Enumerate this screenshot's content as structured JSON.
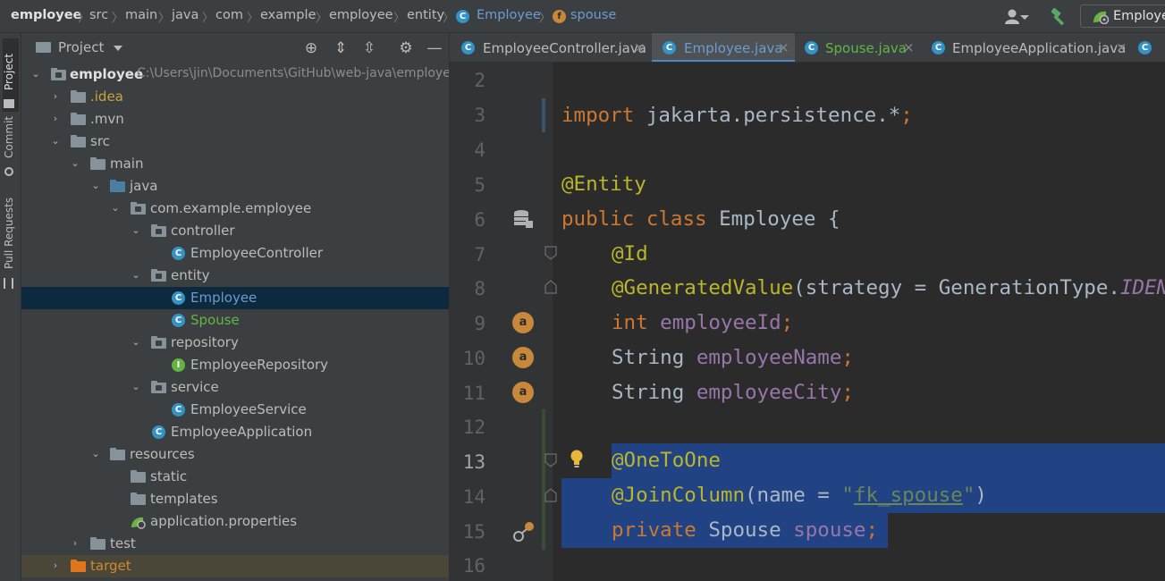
{
  "breadcrumb": {
    "project": "employee",
    "parts": [
      "src",
      "main",
      "java",
      "com",
      "example",
      "employee",
      "entity"
    ],
    "class_name": "Employee",
    "field_name": "spouse"
  },
  "toolbar": {
    "run_config_label": "Employee"
  },
  "left_strip": {
    "tabs": [
      "Project",
      "Commit",
      "Pull Requests"
    ]
  },
  "project_panel": {
    "title": "Project",
    "tree": [
      {
        "label": "employee",
        "path": "C:\\Users\\jin\\Documents\\GitHub\\web-java\\employee"
      },
      {
        "label": ".idea"
      },
      {
        "label": ".mvn"
      },
      {
        "label": "src"
      },
      {
        "label": "main"
      },
      {
        "label": "java"
      },
      {
        "label": "com.example.employee"
      },
      {
        "label": "controller"
      },
      {
        "label": "EmployeeController"
      },
      {
        "label": "entity"
      },
      {
        "label": "Employee"
      },
      {
        "label": "Spouse"
      },
      {
        "label": "repository"
      },
      {
        "label": "EmployeeRepository"
      },
      {
        "label": "service"
      },
      {
        "label": "EmployeeService"
      },
      {
        "label": "EmployeeApplication"
      },
      {
        "label": "resources"
      },
      {
        "label": "static"
      },
      {
        "label": "templates"
      },
      {
        "label": "application.properties"
      },
      {
        "label": "test"
      },
      {
        "label": "target"
      }
    ]
  },
  "tabs": [
    {
      "label": "EmployeeController.java"
    },
    {
      "label": "Employee.java"
    },
    {
      "label": "Spouse.java"
    },
    {
      "label": "EmployeeApplication.java"
    }
  ],
  "editor": {
    "line_numbers": [
      "2",
      "3",
      "4",
      "5",
      "6",
      "7",
      "8",
      "9",
      "10",
      "11",
      "12",
      "13",
      "14",
      "15",
      "16"
    ],
    "code": {
      "l3_import": "import",
      "l3_rest": " jakarta.persistence.*",
      "l3_semi": ";",
      "l5": "@Entity",
      "l6_kw": "public class",
      "l6_rest": " Employee {",
      "l7": "@Id",
      "l8_ann": "@GeneratedValue",
      "l8_rest": "(strategy = GenerationType.",
      "l8_const": "IDENTITY",
      "l9_kw": "int",
      "l9_field": " employeeId",
      "l9_semi": ";",
      "l10_type": "String",
      "l10_field": " employeeName",
      "l10_semi": ";",
      "l11_type": "String",
      "l11_field": " employeeCity",
      "l11_semi": ";",
      "l13": "@OneToOne",
      "l14_ann": "@JoinColumn",
      "l14_open": "(name = ",
      "l14_q1": "\"",
      "l14_str": "fk_spouse",
      "l14_q2": "\"",
      "l14_close": ")",
      "l15_kw": "private",
      "l15_type": " Spouse",
      "l15_field": " spouse",
      "l15_semi": ";"
    }
  },
  "colors": {
    "keyword": "#cc7832",
    "annotation": "#bbb529",
    "field": "#9876aa",
    "string": "#6a8759",
    "selection": "#214283",
    "accent": "#4a88c7"
  }
}
